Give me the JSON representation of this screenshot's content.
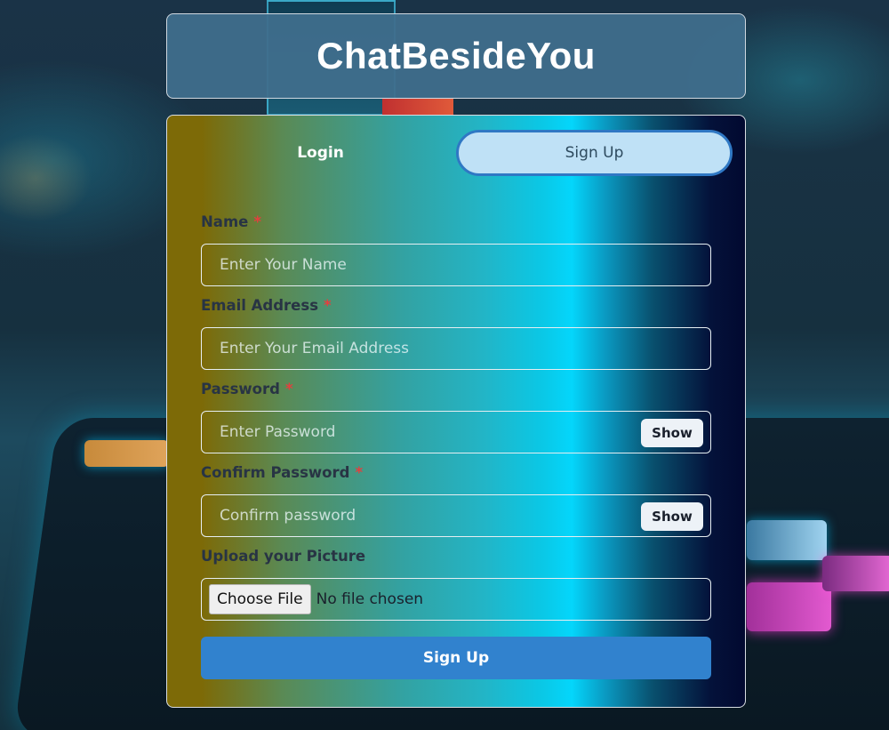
{
  "app": {
    "title": "ChatBesideYou"
  },
  "tabs": [
    {
      "label": "Login",
      "active": false
    },
    {
      "label": "Sign Up",
      "active": true
    }
  ],
  "form": {
    "name": {
      "label": "Name",
      "required_mark": "*",
      "placeholder": "Enter Your Name",
      "value": ""
    },
    "email": {
      "label": "Email Address",
      "required_mark": "*",
      "placeholder": "Enter Your Email Address",
      "value": ""
    },
    "password": {
      "label": "Password",
      "required_mark": "*",
      "placeholder": "Enter Password",
      "value": "",
      "toggle_label": "Show"
    },
    "confirm_password": {
      "label": "Confirm Password",
      "required_mark": "*",
      "placeholder": "Confirm password",
      "value": "",
      "toggle_label": "Show"
    },
    "picture": {
      "label": "Upload your Picture",
      "button_label": "Choose File",
      "status": "No file chosen"
    },
    "submit_label": "Sign Up"
  },
  "colors": {
    "title_bg": "#3f6e8c",
    "submit_bg": "#3182ce",
    "active_tab_bg": "#bfe1f6",
    "active_tab_border": "#2f78c4",
    "required": "#e53e3e"
  }
}
